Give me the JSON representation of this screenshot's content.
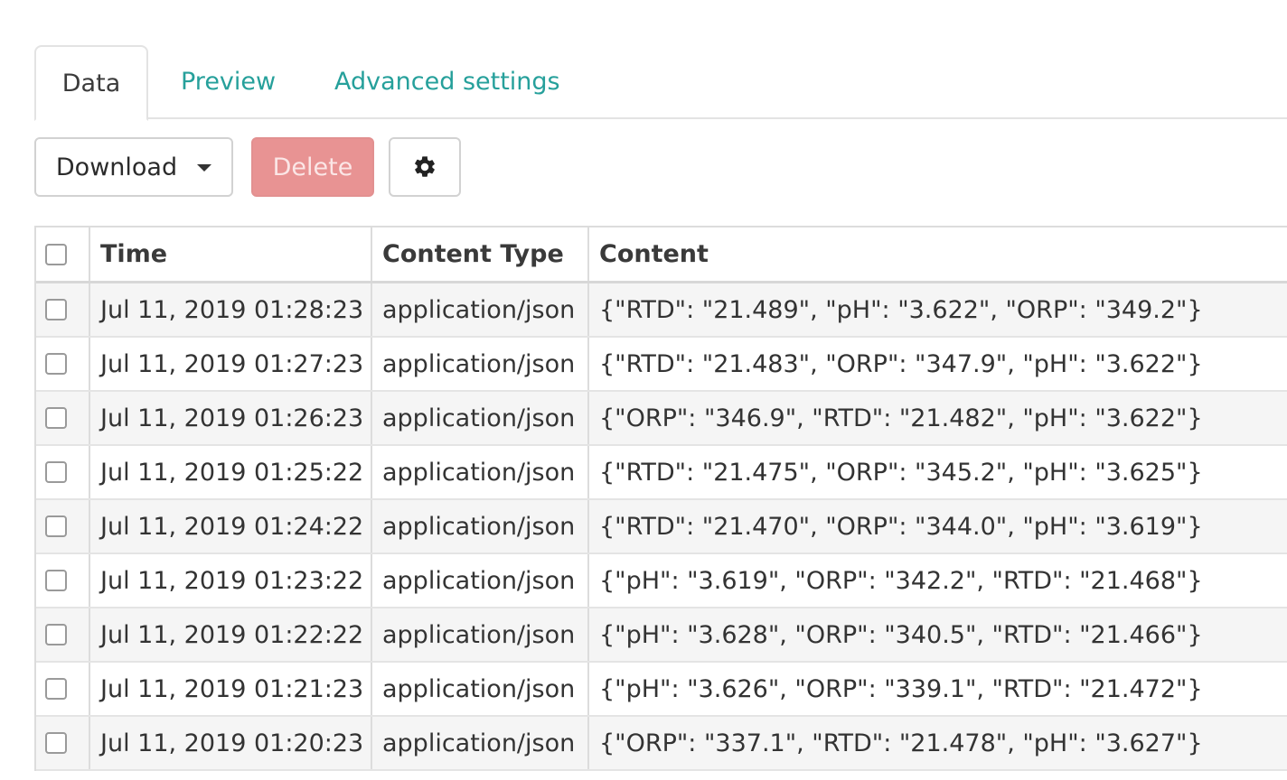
{
  "tabs": [
    {
      "label": "Data"
    },
    {
      "label": "Preview"
    },
    {
      "label": "Advanced settings"
    }
  ],
  "toolbar": {
    "download_label": "Download",
    "delete_label": "Delete",
    "settings_icon": "gear-icon"
  },
  "table": {
    "columns": [
      "Time",
      "Content Type",
      "Content"
    ],
    "rows": [
      {
        "time": "Jul 11, 2019 01:28:23",
        "content_type": "application/json",
        "content": "{\"RTD\": \"21.489\", \"pH\": \"3.622\", \"ORP\": \"349.2\"}"
      },
      {
        "time": "Jul 11, 2019 01:27:23",
        "content_type": "application/json",
        "content": "{\"RTD\": \"21.483\", \"ORP\": \"347.9\", \"pH\": \"3.622\"}"
      },
      {
        "time": "Jul 11, 2019 01:26:23",
        "content_type": "application/json",
        "content": "{\"ORP\": \"346.9\", \"RTD\": \"21.482\", \"pH\": \"3.622\"}"
      },
      {
        "time": "Jul 11, 2019 01:25:22",
        "content_type": "application/json",
        "content": "{\"RTD\": \"21.475\", \"ORP\": \"345.2\", \"pH\": \"3.625\"}"
      },
      {
        "time": "Jul 11, 2019 01:24:22",
        "content_type": "application/json",
        "content": "{\"RTD\": \"21.470\", \"ORP\": \"344.0\", \"pH\": \"3.619\"}"
      },
      {
        "time": "Jul 11, 2019 01:23:22",
        "content_type": "application/json",
        "content": "{\"pH\": \"3.619\", \"ORP\": \"342.2\", \"RTD\": \"21.468\"}"
      },
      {
        "time": "Jul 11, 2019 01:22:22",
        "content_type": "application/json",
        "content": "{\"pH\": \"3.628\", \"ORP\": \"340.5\", \"RTD\": \"21.466\"}"
      },
      {
        "time": "Jul 11, 2019 01:21:23",
        "content_type": "application/json",
        "content": "{\"pH\": \"3.626\", \"ORP\": \"339.1\", \"RTD\": \"21.472\"}"
      },
      {
        "time": "Jul 11, 2019 01:20:23",
        "content_type": "application/json",
        "content": "{\"ORP\": \"337.1\", \"RTD\": \"21.478\", \"pH\": \"3.627\"}"
      }
    ]
  }
}
